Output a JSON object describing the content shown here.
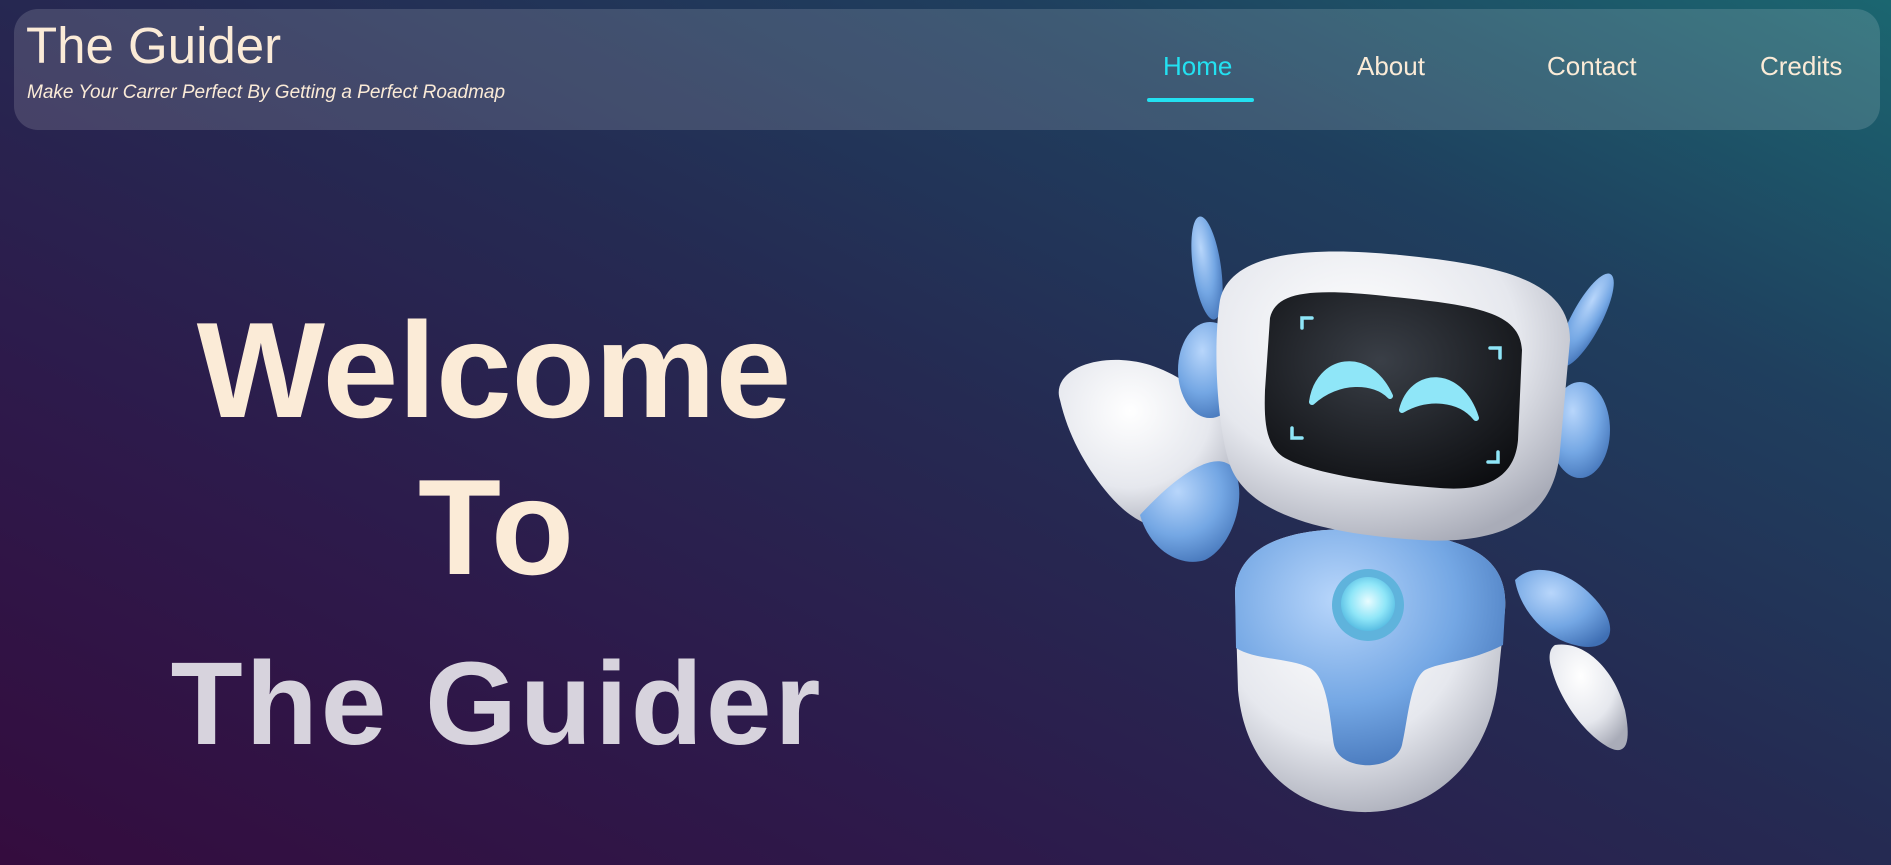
{
  "header": {
    "title": "The Guider",
    "tagline": "Make Your Carrer Perfect By Getting a Perfect Roadmap"
  },
  "nav": {
    "active_item": "Home",
    "items": [
      {
        "label": "Home"
      },
      {
        "label": "About"
      },
      {
        "label": "Contact"
      },
      {
        "label": "Credits"
      }
    ]
  },
  "hero": {
    "line1": "Welcome",
    "line2": "To",
    "line3": "The Guider"
  },
  "illustration": {
    "icon": "robot-mascot-icon"
  },
  "colors": {
    "accent": "#23e1f1",
    "text": "#fbebd7",
    "brand_text": "#d7d3dd",
    "robot_blue": "#6fa3e0"
  }
}
